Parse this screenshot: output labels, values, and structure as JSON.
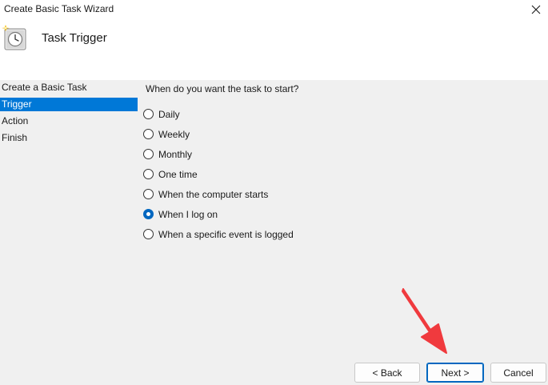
{
  "window": {
    "title": "Create Basic Task Wizard",
    "close_icon": "close-icon"
  },
  "header": {
    "icon": "task-scheduler-clock-icon",
    "title": "Task Trigger"
  },
  "sidebar": {
    "items": [
      {
        "label": "Create a Basic Task",
        "selected": false
      },
      {
        "label": "Trigger",
        "selected": true
      },
      {
        "label": "Action",
        "selected": false
      },
      {
        "label": "Finish",
        "selected": false
      }
    ],
    "selected_color": "#0078d7"
  },
  "main": {
    "question": "When do you want the task to start?",
    "options": [
      {
        "label": "Daily",
        "checked": false
      },
      {
        "label": "Weekly",
        "checked": false
      },
      {
        "label": "Monthly",
        "checked": false
      },
      {
        "label": "One time",
        "checked": false
      },
      {
        "label": "When the computer starts",
        "checked": false
      },
      {
        "label": "When I log on",
        "checked": true
      },
      {
        "label": "When a specific event is logged",
        "checked": false
      }
    ]
  },
  "footer": {
    "back_label": "< Back",
    "next_label": "Next >",
    "cancel_label": "Cancel"
  },
  "annotation": {
    "arrow_color": "#f03a3e"
  }
}
